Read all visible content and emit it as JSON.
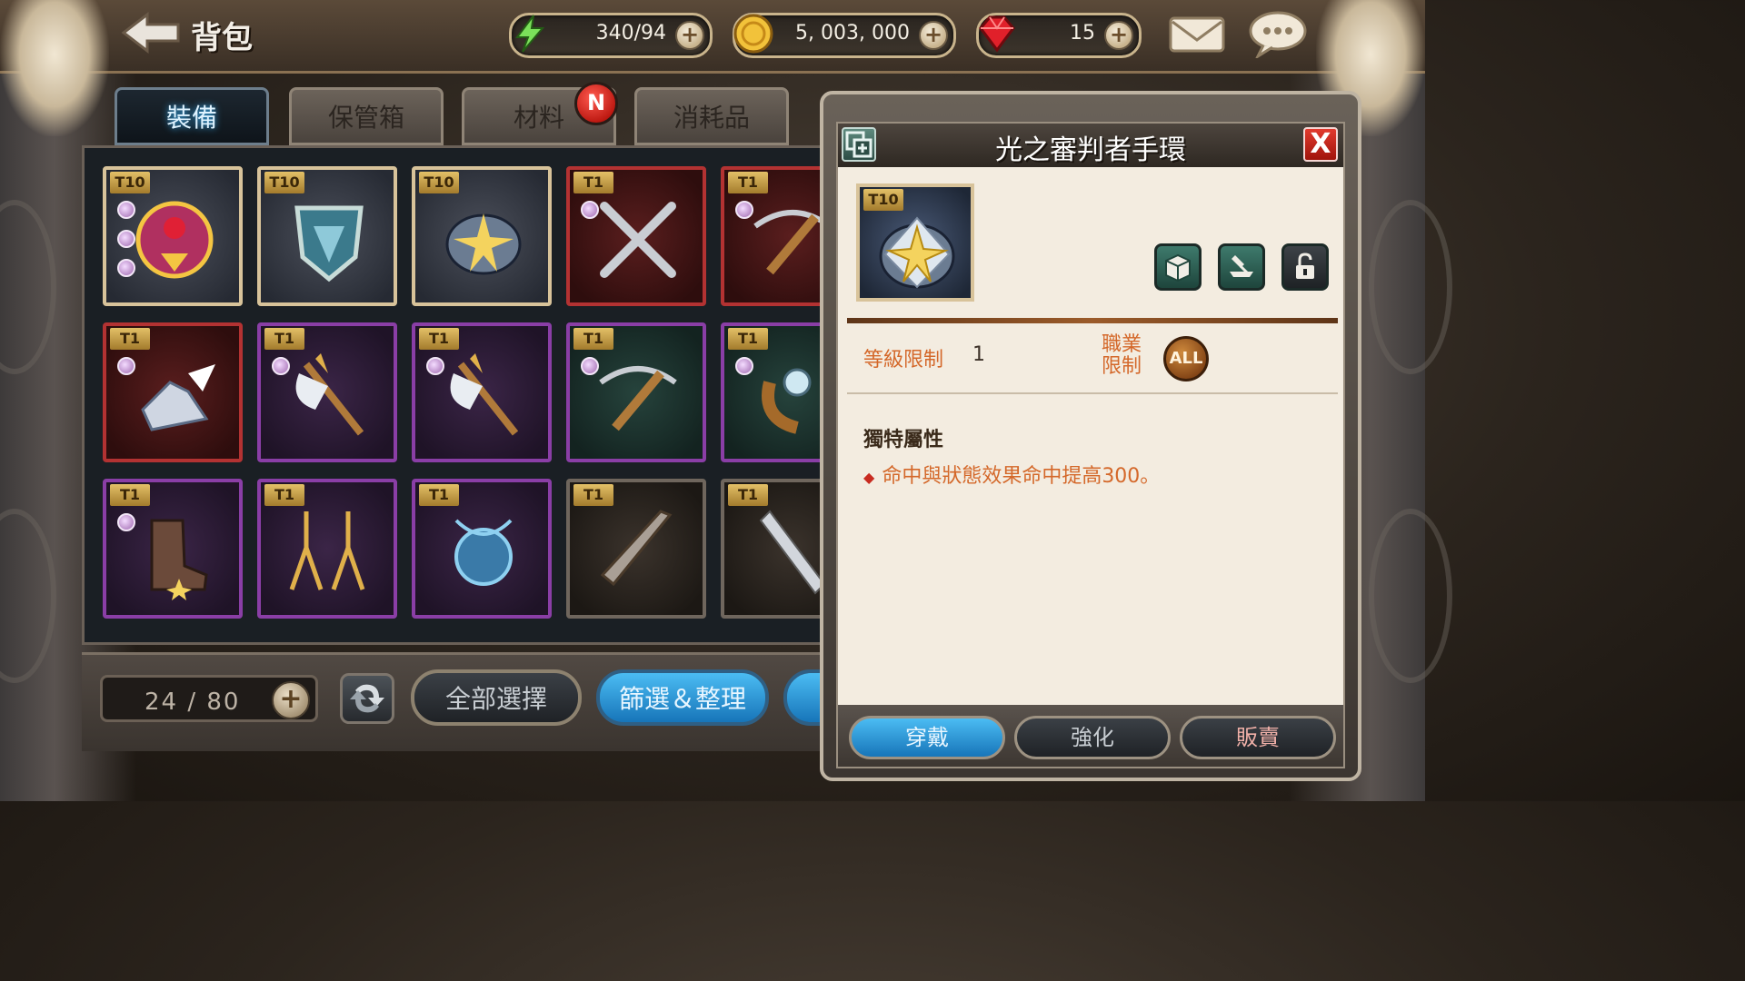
{
  "header": {
    "title": "背包"
  },
  "resources": {
    "stamina": "340/94",
    "gold": "5, 003, 000",
    "gems": "15"
  },
  "tabs": [
    {
      "label": "裝備",
      "active": true
    },
    {
      "label": "保管箱",
      "active": false
    },
    {
      "label": "材料",
      "active": false,
      "badge": "N"
    },
    {
      "label": "消耗品",
      "active": false
    }
  ],
  "inventory": {
    "items": [
      {
        "tier": "T10",
        "frame": "gold",
        "gems": 3,
        "icon": "ruby-amulet-icon"
      },
      {
        "tier": "T10",
        "frame": "gold",
        "gems": 0,
        "icon": "shield-icon"
      },
      {
        "tier": "T10",
        "frame": "gold",
        "gems": 0,
        "icon": "gauntlet-icon"
      },
      {
        "tier": "T1",
        "frame": "red",
        "gems": 1,
        "icon": "crossed-blades-icon"
      },
      {
        "tier": "T1",
        "frame": "red",
        "gems": 1,
        "icon": "crossbow-icon"
      },
      {
        "tier": "T1",
        "frame": "red",
        "gems": 1,
        "icon": "winged-boots-icon"
      },
      {
        "tier": "T1",
        "frame": "purple",
        "gems": 1,
        "icon": "axe-icon"
      },
      {
        "tier": "T1",
        "frame": "purple",
        "gems": 1,
        "icon": "axe-icon"
      },
      {
        "tier": "T1",
        "frame": "green",
        "gems": 1,
        "icon": "crossbow-icon"
      },
      {
        "tier": "T1",
        "frame": "green",
        "gems": 1,
        "icon": "orb-icon"
      },
      {
        "tier": "T1",
        "frame": "purple",
        "gems": 1,
        "icon": "boot-icon"
      },
      {
        "tier": "T1",
        "frame": "purple",
        "gems": 0,
        "icon": "earrings-icon"
      },
      {
        "tier": "T1",
        "frame": "purple",
        "gems": 0,
        "icon": "blue-necklace-icon"
      },
      {
        "tier": "T1",
        "frame": "brown",
        "gems": 0,
        "icon": "greatsword-icon"
      },
      {
        "tier": "T1",
        "frame": "brown",
        "gems": 0,
        "icon": "blade-icon"
      }
    ]
  },
  "bottom": {
    "count": "24  /  80",
    "select_all": "全部選擇",
    "filter_sort": "篩選＆整理"
  },
  "detail": {
    "title": "光之審判者手環",
    "tier": "T10",
    "level_label": "等級限制",
    "level_value": "1",
    "job_label_1": "職業",
    "job_label_2": "限制",
    "job_badge": "ALL",
    "unique_title": "獨特屬性",
    "unique_attr": "命中與狀態效果命中提高300。",
    "equip": "穿戴",
    "enhance": "強化",
    "sell": "販賣"
  },
  "colors": {
    "accent_blue": "#1775b9",
    "stat_orange": "#d4682a",
    "close_red": "#c82b20"
  }
}
